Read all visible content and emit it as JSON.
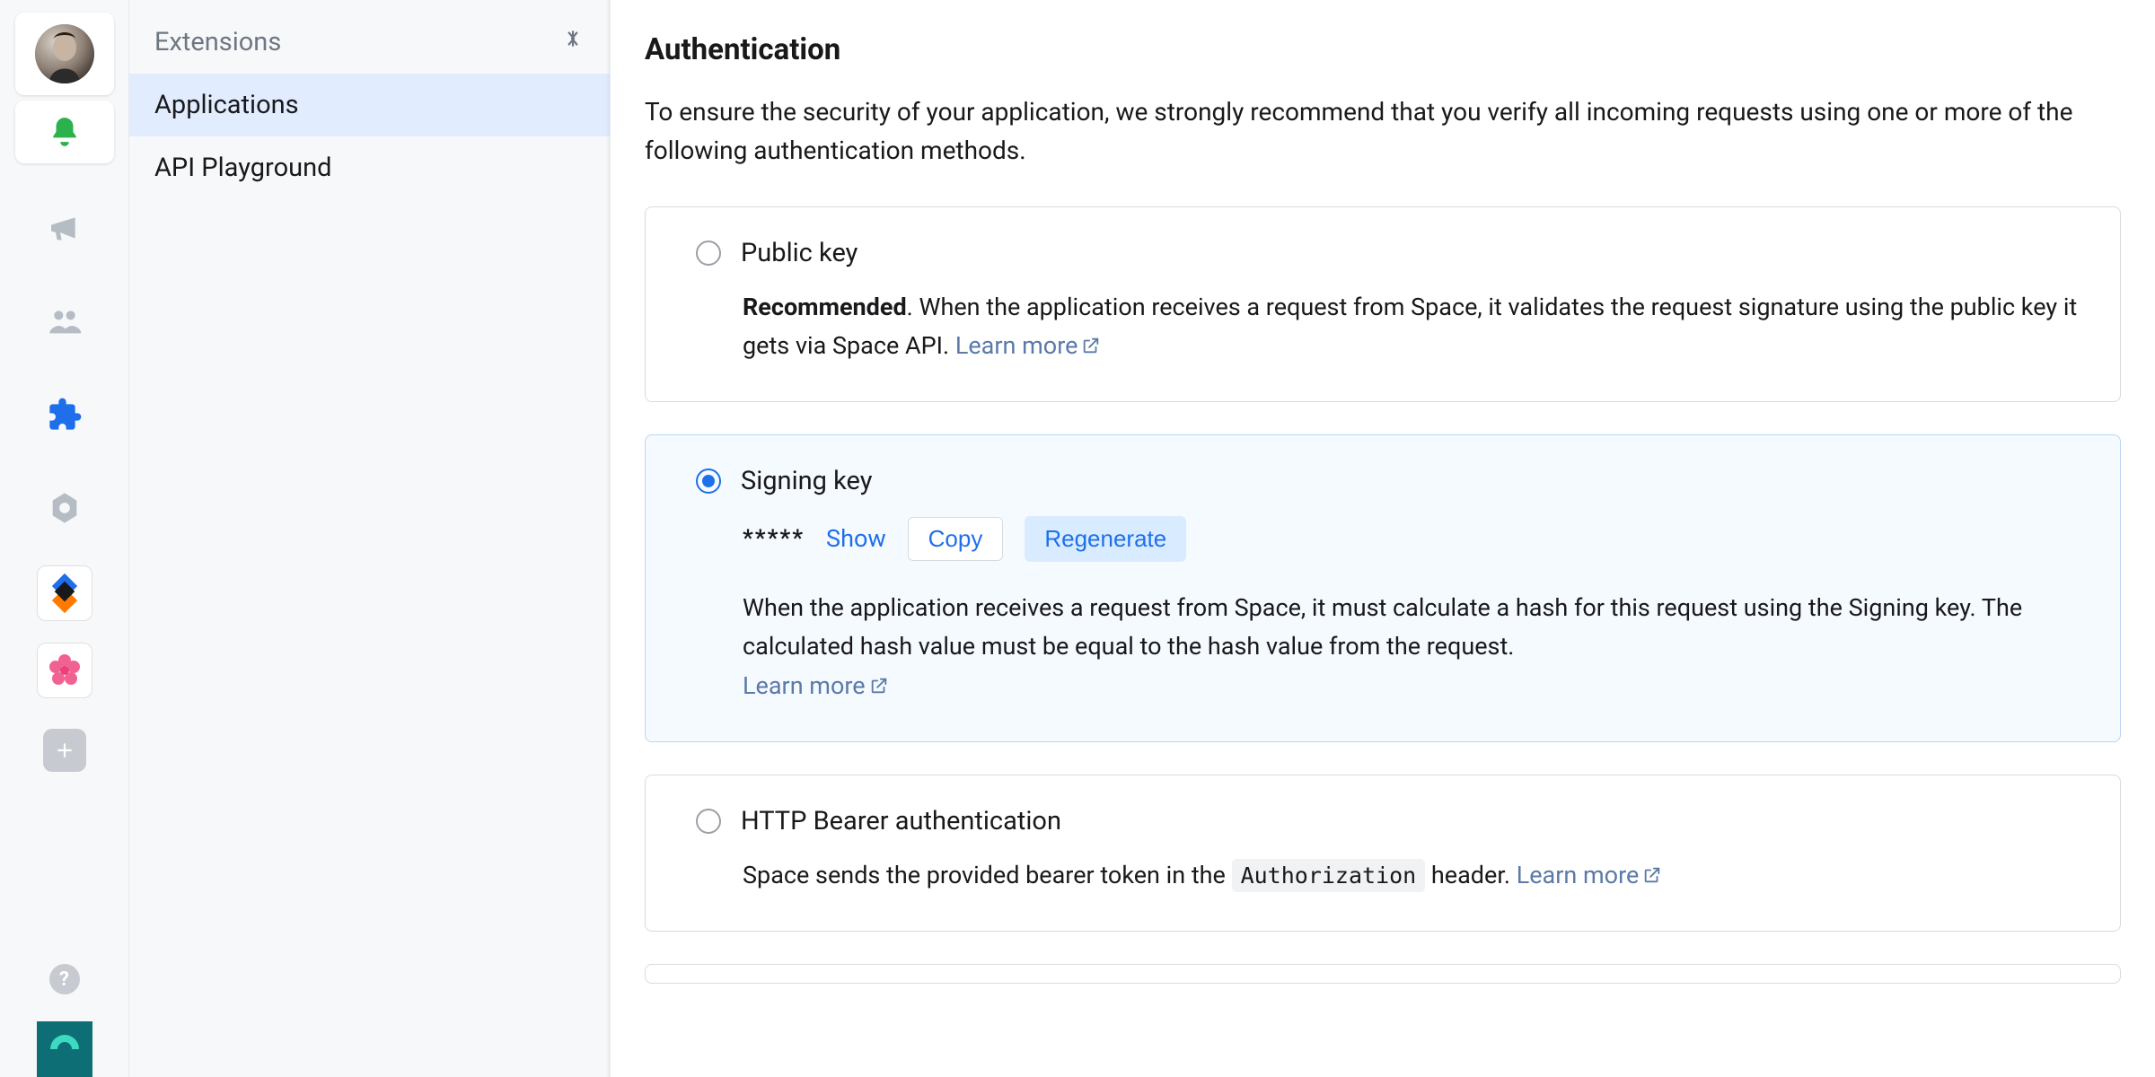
{
  "sidebar": {
    "title": "Extensions",
    "items": [
      {
        "label": "Applications",
        "selected": true
      },
      {
        "label": "API Playground",
        "selected": false
      }
    ]
  },
  "page": {
    "title": "Authentication",
    "description": "To ensure the security of your application, we strongly recommend that you verify all incoming requests using one or more of the following authentication methods."
  },
  "auth_methods": {
    "public_key": {
      "title": "Public key",
      "recommended_label": "Recommended",
      "description_after_recommended": ". When the application receives a request from Space, it validates the request signature using the public key it gets via Space API. ",
      "learn_more": "Learn more"
    },
    "signing_key": {
      "title": "Signing key",
      "masked_value": "*****",
      "show_label": "Show",
      "copy_label": "Copy",
      "regenerate_label": "Regenerate",
      "description": "When the application receives a request from Space, it must calculate a hash for this request using the Signing key. The calculated hash value must be equal to the hash value from the request.",
      "learn_more": "Learn more"
    },
    "bearer": {
      "title": "HTTP Bearer authentication",
      "description_before_code": "Space sends the provided bearer token in the ",
      "code": "Authorization",
      "description_after_code": " header. ",
      "learn_more": "Learn more"
    }
  }
}
